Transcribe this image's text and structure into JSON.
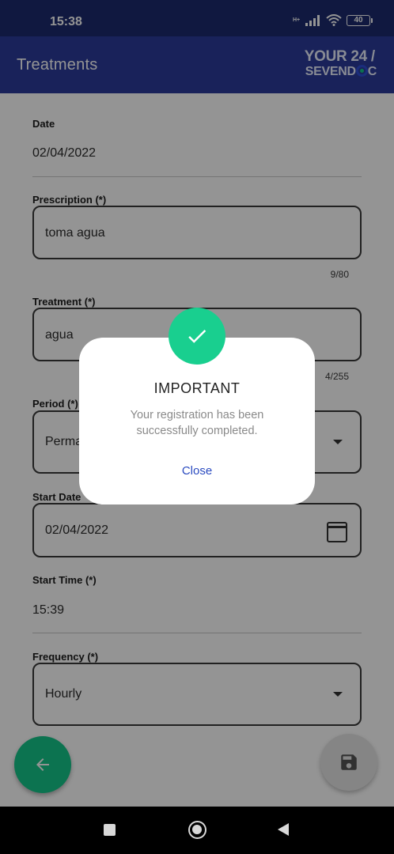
{
  "status_bar": {
    "time": "15:38",
    "network_type": "H+",
    "battery": "40"
  },
  "app_bar": {
    "title": "Treatments",
    "logo_line1": "YOUR 24 /",
    "logo_line2_prefix": "SEVEND",
    "logo_line2_suffix": "C"
  },
  "form": {
    "date": {
      "label": "Date",
      "value": "02/04/2022"
    },
    "prescription": {
      "label": "Prescription (*)",
      "value": "toma agua",
      "counter": "9/80"
    },
    "treatment": {
      "label": "Treatment (*)",
      "value": "agua",
      "counter": "4/255"
    },
    "period": {
      "label": "Period (*)",
      "value": "Perma"
    },
    "start_date": {
      "label": "Start Date",
      "value": "02/04/2022"
    },
    "start_time": {
      "label": "Start Time (*)",
      "value": "15:39"
    },
    "frequency": {
      "label": "Frequency (*)",
      "value": "Hourly"
    }
  },
  "dialog": {
    "title": "IMPORTANT",
    "message": "Your registration has been successfully completed.",
    "close_label": "Close"
  },
  "colors": {
    "primary": "#2b3b9b",
    "status_bar": "#1d2a6e",
    "accent": "#19cf8f",
    "link": "#2b4bc0"
  }
}
